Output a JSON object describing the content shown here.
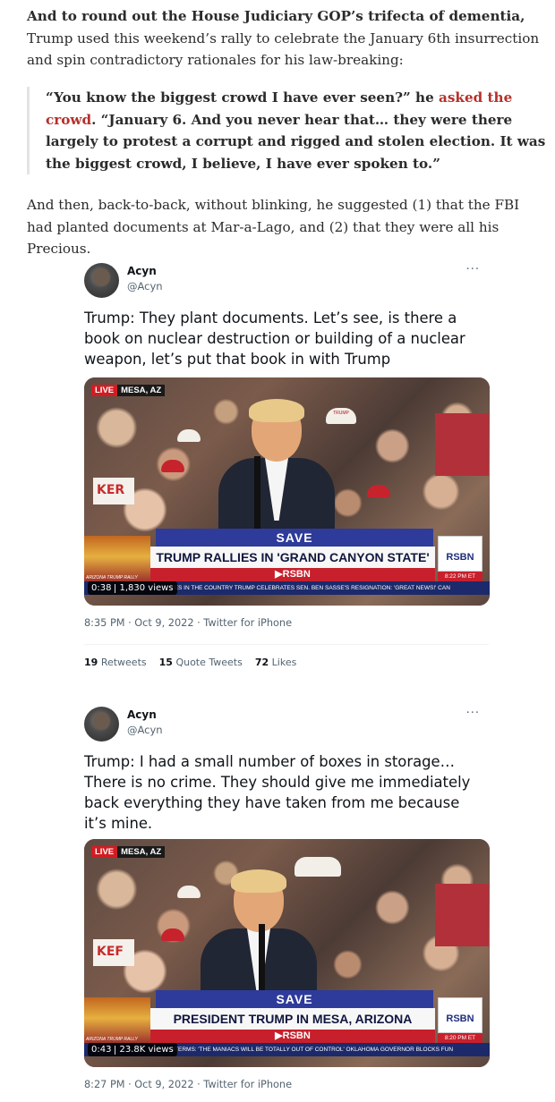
{
  "article": {
    "p1_lead": "And to round out the House Judiciary GOP’s trifecta of dementia,",
    "p1_rest": " Trump used this weekend’s rally to celebrate the January 6th insurrection and spin contradictory rationales for his law-breaking:",
    "quote_a": "“You know the biggest crowd I have ever seen?” he ",
    "quote_link": "asked the crowd",
    "quote_b": ". “January 6. And you never hear that… they were there largely to protest a corrupt and rigged and stolen election. It was the biggest crowd, I believe, I have ever spoken to.”",
    "p2": "And then, back-to-back, without blinking, he suggested (1) that the FBI had planted documents at Mar-a-Lago, and (2) that they were all his Precious."
  },
  "tweets": [
    {
      "author": "Acyn",
      "handle": "@Acyn",
      "more": "···",
      "text": "Trump: They plant documents. Let’s see, is there a book on nuclear destruction or building of a nuclear weapon, let’s put that book in with Trump",
      "video": {
        "live": "LIVE",
        "location": "MESA, AZ",
        "save": "SAVE",
        "headline": "TRUMP RALLIES IN 'GRAND CANYON STATE'",
        "network": "▶RSBN",
        "thumb_label": "ARIZONA TRUMP RALLY",
        "logo": "RSBN",
        "clock": "8:22 PM ET",
        "ticker": "CES IN THE COUNTRY    TRUMP CELEBRATES SEN. BEN SASSE'S RESIGNATION: 'GREAT NEWS!'    CAN",
        "duration": "0:38",
        "views": "1,830 views",
        "sign": "KER",
        "hat_text": "TRUMP"
      },
      "meta": "8:35 PM · Oct 9, 2022 · Twitter for iPhone",
      "stats": {
        "retweets_count": "19",
        "retweets_label": "Retweets",
        "quotes_count": "15",
        "quotes_label": "Quote Tweets",
        "likes_count": "72",
        "likes_label": "Likes"
      }
    },
    {
      "author": "Acyn",
      "handle": "@Acyn",
      "more": "···",
      "text": "Trump: I had a small number of boxes in storage… There is no crime. They should give me immediately back everything they have taken from me because it’s mine.",
      "video": {
        "live": "LIVE",
        "location": "MESA, AZ",
        "save": "SAVE",
        "headline": "PRESIDENT TRUMP IN MESA, ARIZONA",
        "network": "▶RSBN",
        "thumb_label": "ARIZONA TRUMP RALLY",
        "logo": "RSBN",
        "clock": "8:20 PM ET",
        "ticker": "OTERMS: 'THE MANIACS WILL BE TOTALLY OUT OF CONTROL'    OKLAHOMA GOVERNOR BLOCKS FUN",
        "duration": "0:43",
        "views": "23.8K views",
        "sign": "KEF"
      },
      "meta": "8:27 PM · Oct 9, 2022 · Twitter for iPhone"
    }
  ],
  "colors": {
    "link": "#b5302a",
    "chyron_blue": "#2e3b9a",
    "chyron_red": "#c7202c",
    "live_red": "#d11d22"
  }
}
